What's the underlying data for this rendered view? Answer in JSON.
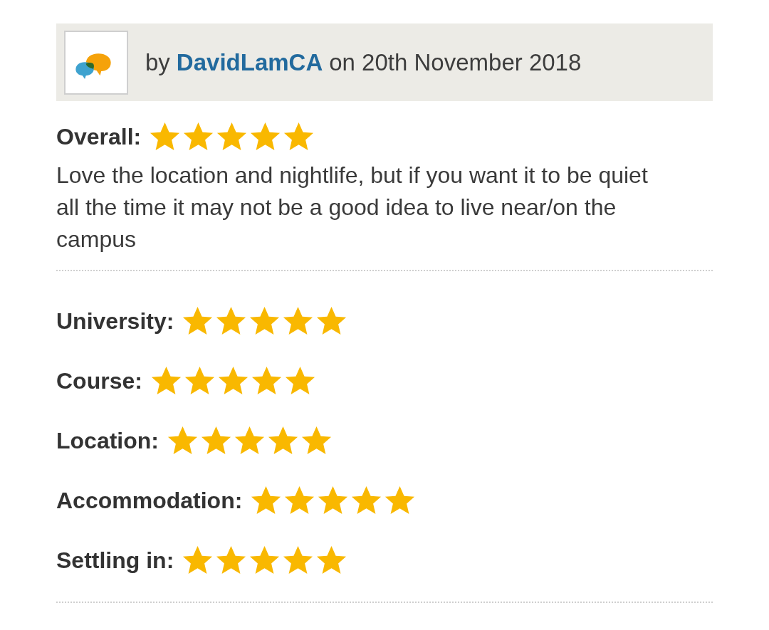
{
  "review": {
    "byline": {
      "prefix": "by",
      "author": "DavidLamCA",
      "date": "on 20th November 2018"
    },
    "overall": {
      "label": "Overall:",
      "stars": 5
    },
    "text": "Love the location and nightlife, but if you want it to be quiet all the time it may not be a good idea to live near/on the campus",
    "ratings": [
      {
        "label": "University:",
        "stars": 5
      },
      {
        "label": "Course:",
        "stars": 5
      },
      {
        "label": "Location:",
        "stars": 5
      },
      {
        "label": "Accommodation:",
        "stars": 5
      },
      {
        "label": "Settling in:",
        "stars": 5
      }
    ]
  }
}
